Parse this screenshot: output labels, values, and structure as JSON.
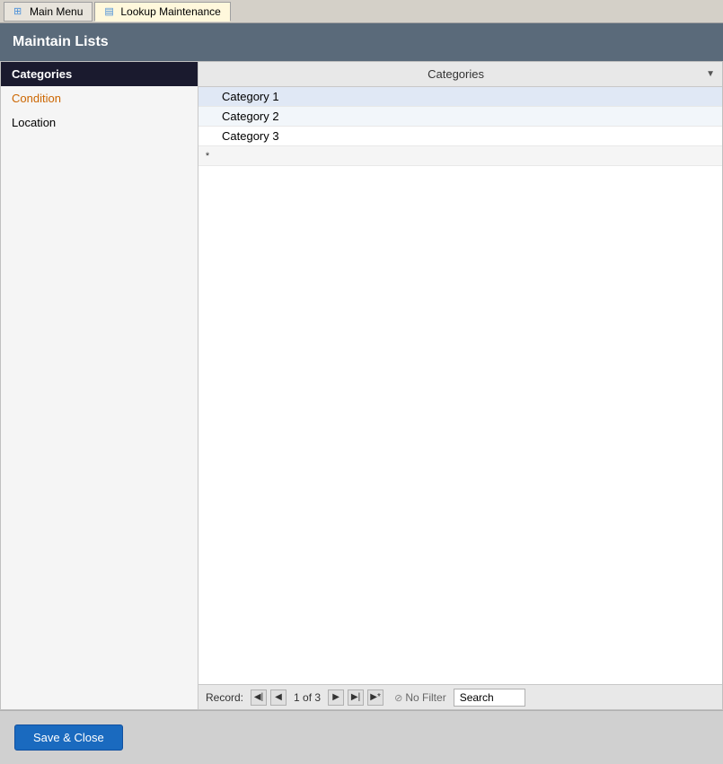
{
  "tabs": [
    {
      "id": "main-menu",
      "label": "Main Menu",
      "icon": "grid",
      "active": false
    },
    {
      "id": "lookup-maintenance",
      "label": "Lookup Maintenance",
      "icon": "list",
      "active": true
    }
  ],
  "header": {
    "title": "Maintain Lists"
  },
  "sidebar": {
    "items": [
      {
        "id": "categories",
        "label": "Categories",
        "selected": true,
        "style": "selected"
      },
      {
        "id": "condition",
        "label": "Condition",
        "selected": false,
        "style": "condition"
      },
      {
        "id": "location",
        "label": "Location",
        "selected": false,
        "style": "location"
      }
    ]
  },
  "grid": {
    "column_header": "Categories",
    "rows": [
      {
        "id": 1,
        "value": "Category 1",
        "indicator": ""
      },
      {
        "id": 2,
        "value": "Category 2",
        "indicator": ""
      },
      {
        "id": 3,
        "value": "Category 3",
        "indicator": ""
      },
      {
        "id": 4,
        "value": "",
        "indicator": "*"
      }
    ]
  },
  "nav": {
    "record_label": "Record:",
    "record_info": "1 of 3",
    "filter_label": "No Filter",
    "search_placeholder": "Search",
    "search_value": "Search",
    "buttons": {
      "first": "◀|",
      "prev": "◀",
      "next": "▶",
      "last": "▶|",
      "new": "▶*"
    }
  },
  "footer": {
    "save_close_label": "Save & Close"
  }
}
